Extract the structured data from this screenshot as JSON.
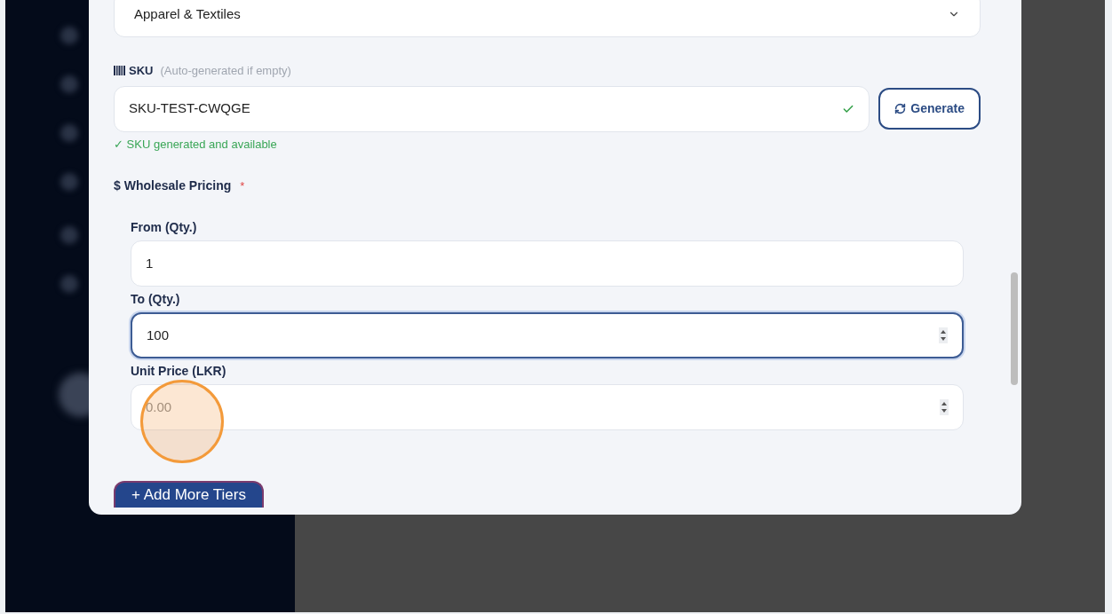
{
  "category_select": {
    "value": "Apparel & Textiles"
  },
  "sku": {
    "label": "SKU",
    "hint": "(Auto-generated if empty)",
    "value": "SKU-TEST-CWQGE",
    "valid": true,
    "status": "✓ SKU generated and available"
  },
  "generate_button": {
    "label": "Generate"
  },
  "wholesale_pricing": {
    "label": "$ Wholesale Pricing",
    "required_mark": "*",
    "tiers": [
      {
        "label": "From (Qty.)",
        "value": "1",
        "stepper": false,
        "focused": false
      },
      {
        "label": "To (Qty.)",
        "value": "100",
        "stepper": true,
        "focused": true
      },
      {
        "label": "Unit Price (LKR)",
        "placeholder": "0.00",
        "stepper": true,
        "focused": false
      }
    ]
  },
  "add_tiers_button": {
    "label": "+ Add More Tiers"
  }
}
